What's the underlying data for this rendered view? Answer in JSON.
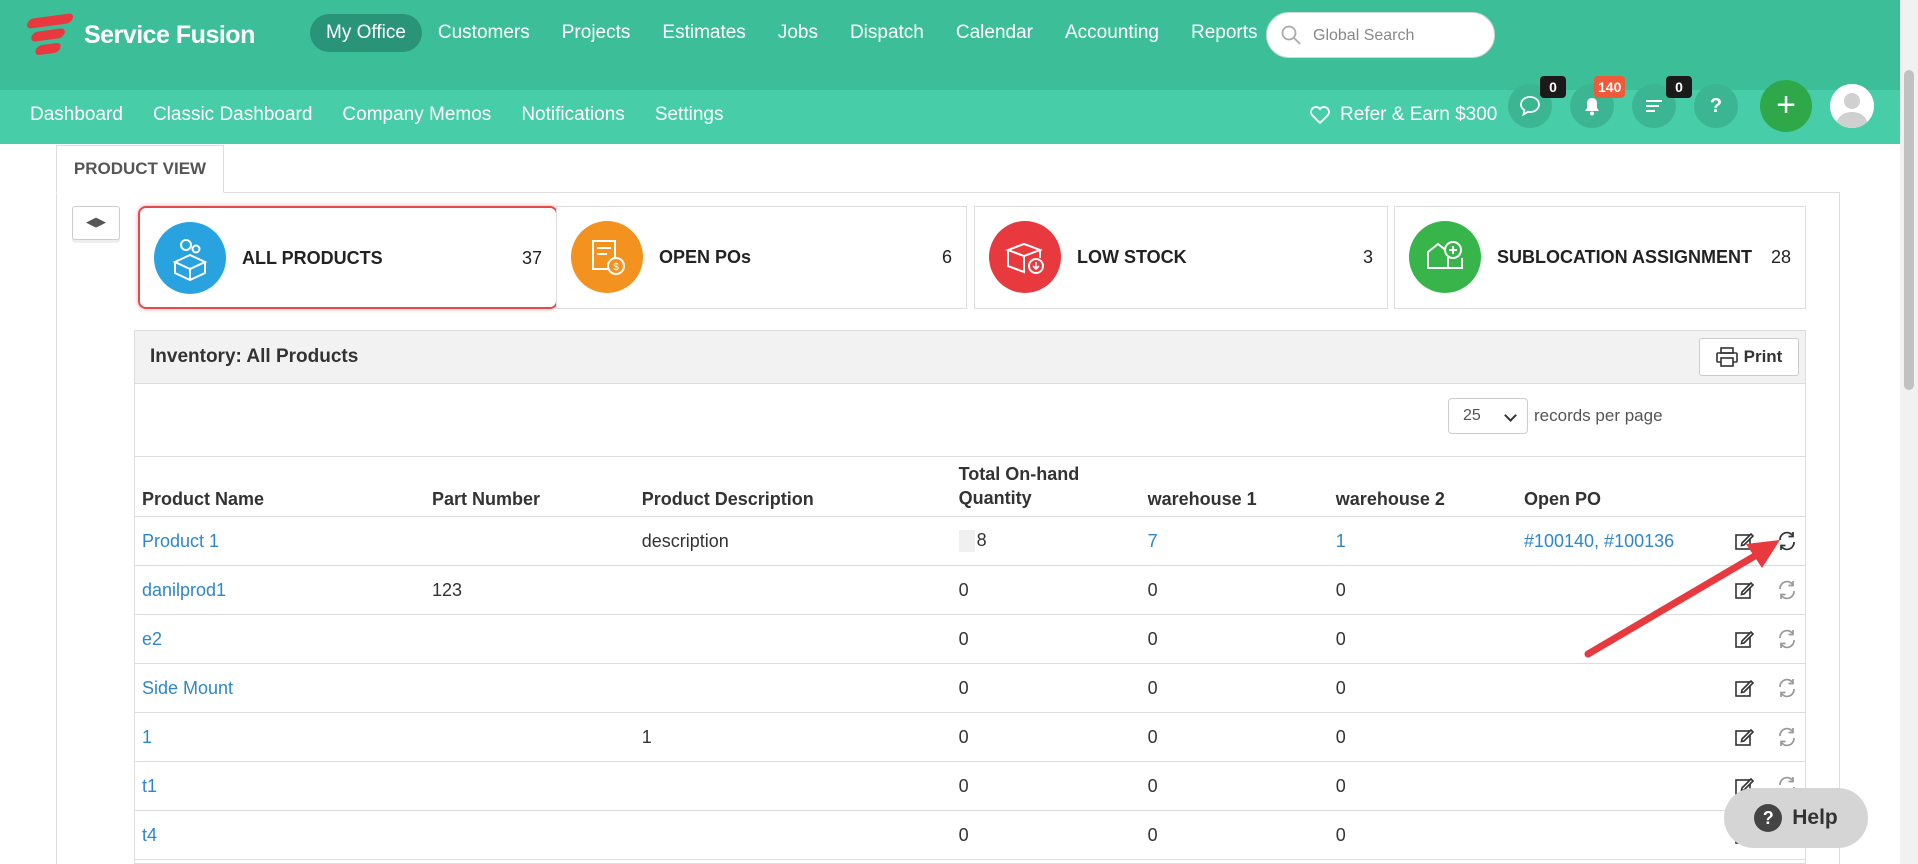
{
  "brand": {
    "name": "Service Fusion"
  },
  "main_nav": [
    "My Office",
    "Customers",
    "Projects",
    "Estimates",
    "Jobs",
    "Dispatch",
    "Calendar",
    "Accounting",
    "Reports"
  ],
  "search": {
    "placeholder": "Global Search"
  },
  "sub_nav": [
    "Dashboard",
    "Classic Dashboard",
    "Company Memos",
    "Notifications",
    "Settings"
  ],
  "refer": {
    "label": "Refer & Earn $300"
  },
  "header_icons": {
    "messages_count": "0",
    "notifications_count": "140",
    "tasks_count": "0",
    "help_label": "?",
    "add_label": "+"
  },
  "view_tab": {
    "label": "PRODUCT VIEW"
  },
  "cards": [
    {
      "label": "ALL PRODUCTS",
      "count": "37",
      "color": "#29a3df"
    },
    {
      "label": "OPEN POs",
      "count": "6",
      "color": "#f3921f"
    },
    {
      "label": "LOW STOCK",
      "count": "3",
      "color": "#e8393f"
    },
    {
      "label": "SUBLOCATION ASSIGNMENT",
      "count": "28",
      "color": "#37b54a"
    }
  ],
  "inventory": {
    "title": "Inventory: All Products",
    "print_label": "Print",
    "records_per_page": "25",
    "records_per_page_label": "records per page",
    "columns": [
      "Product Name",
      "Part Number",
      "Product Description",
      "Total On-hand Quantity",
      "warehouse 1",
      "warehouse 2",
      "Open PO"
    ],
    "rows": [
      {
        "name": "Product 1",
        "part": "",
        "desc": "description",
        "total": "8",
        "w1": "7",
        "w2": "1",
        "po": "#100140, #100136"
      },
      {
        "name": "danilprod1",
        "part": "123",
        "desc": "",
        "total": "0",
        "w1": "0",
        "w2": "0",
        "po": ""
      },
      {
        "name": "e2",
        "part": "",
        "desc": "",
        "total": "0",
        "w1": "0",
        "w2": "0",
        "po": ""
      },
      {
        "name": "Side Mount",
        "part": "",
        "desc": "",
        "total": "0",
        "w1": "0",
        "w2": "0",
        "po": ""
      },
      {
        "name": "1",
        "part": "",
        "desc": "1",
        "total": "0",
        "w1": "0",
        "w2": "0",
        "po": ""
      },
      {
        "name": "t1",
        "part": "",
        "desc": "",
        "total": "0",
        "w1": "0",
        "w2": "0",
        "po": ""
      },
      {
        "name": "t4",
        "part": "",
        "desc": "",
        "total": "0",
        "w1": "0",
        "w2": "0",
        "po": ""
      }
    ]
  },
  "help_widget": {
    "label": "Help",
    "icon_text": "?"
  },
  "colors": {
    "topbar": "#3cbf98",
    "subbar": "#47cda8",
    "link": "#2f87c6",
    "highlight": "#e24b4b"
  }
}
